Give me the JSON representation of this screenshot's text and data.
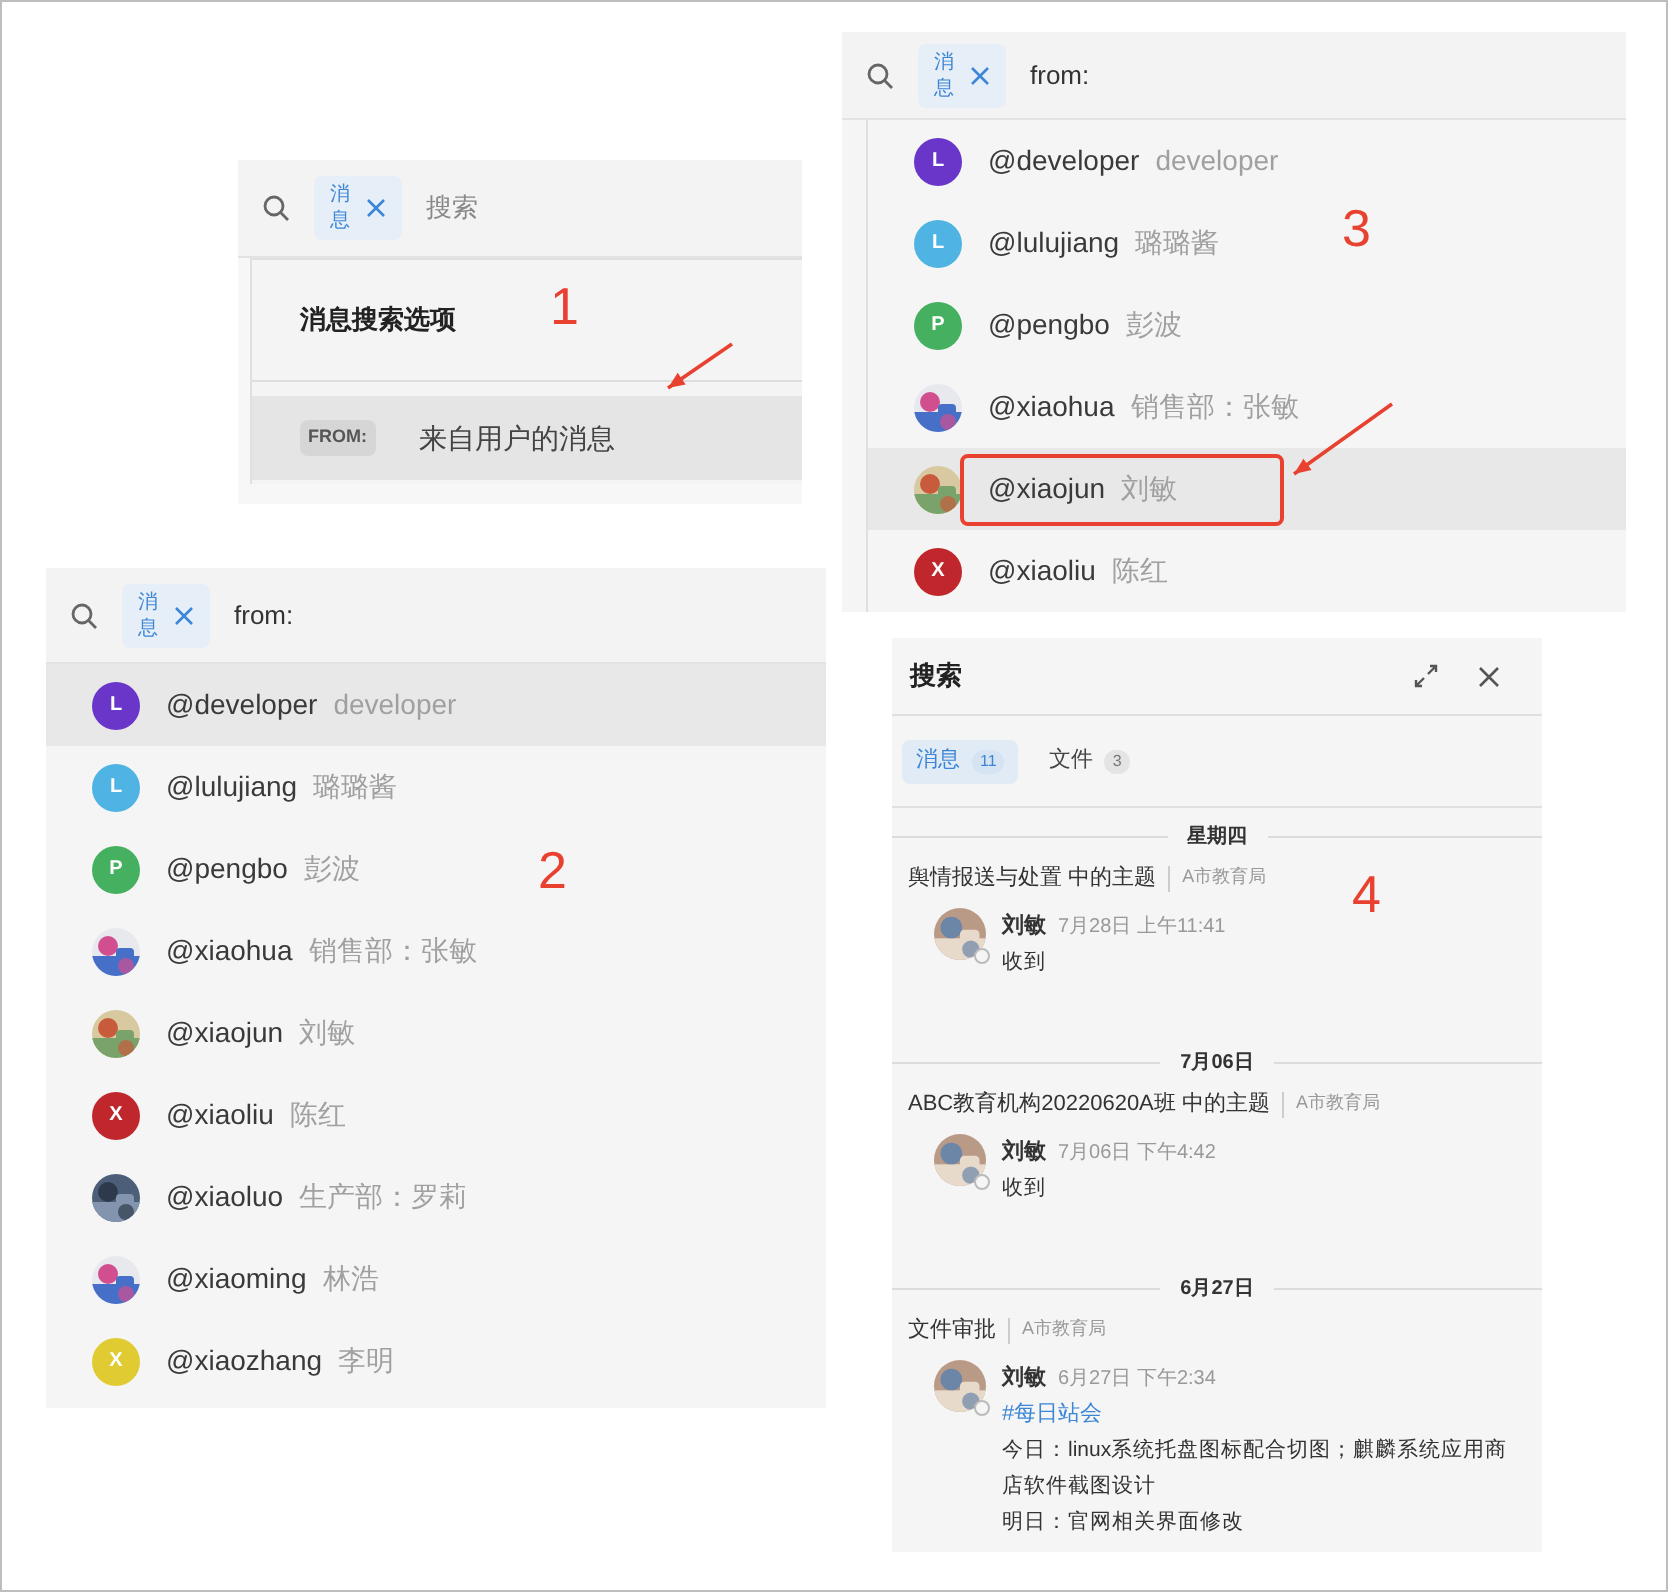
{
  "panel_1": {
    "annotation": "1",
    "search": {
      "chip": "消息",
      "placeholder": "搜索"
    },
    "dropdown": {
      "title": "消息搜索选项",
      "options": [
        {
          "badge": "FROM:",
          "label": "来自用户的消息",
          "selected": true
        }
      ]
    }
  },
  "panel_2": {
    "annotation": "2",
    "search": {
      "chip": "消息",
      "value": "from:"
    },
    "users": [
      {
        "handle": "@developer",
        "name": "developer",
        "avatar": {
          "kind": "letter",
          "letter": "L",
          "color": "#6a35c9"
        },
        "selected": true
      },
      {
        "handle": "@lulujiang",
        "name": "璐璐酱",
        "avatar": {
          "kind": "letter",
          "letter": "L",
          "color": "#4fb3e3"
        },
        "selected": false
      },
      {
        "handle": "@pengbo",
        "name": "彭波",
        "avatar": {
          "kind": "letter",
          "letter": "P",
          "color": "#45b060"
        },
        "selected": false
      },
      {
        "handle": "@xiaohua",
        "name": "销售部：张敏",
        "selected": false
      },
      {
        "handle": "@xiaojun",
        "name": "刘敏",
        "selected": false
      },
      {
        "handle": "@xiaoliu",
        "name": "陈红",
        "avatar": {
          "kind": "letter",
          "letter": "X",
          "color": "#c0272d"
        },
        "selected": false
      },
      {
        "handle": "@xiaoluo",
        "name": "生产部：罗莉",
        "selected": false
      },
      {
        "handle": "@xiaoming",
        "name": "林浩",
        "selected": false
      },
      {
        "handle": "@xiaozhang",
        "name": "李明",
        "avatar": {
          "kind": "letter",
          "letter": "X",
          "color": "#e0cc32"
        },
        "selected": false
      }
    ]
  },
  "panel_3": {
    "annotation": "3",
    "search": {
      "chip": "消息",
      "value": "from:"
    },
    "users": [
      {
        "handle": "@developer",
        "name": "developer",
        "avatar": {
          "kind": "letter",
          "letter": "L",
          "color": "#6a35c9"
        },
        "selected": false,
        "boxed": false
      },
      {
        "handle": "@lulujiang",
        "name": "璐璐酱",
        "avatar": {
          "kind": "letter",
          "letter": "L",
          "color": "#4fb3e3"
        },
        "selected": false,
        "boxed": false
      },
      {
        "handle": "@pengbo",
        "name": "彭波",
        "avatar": {
          "kind": "letter",
          "letter": "P",
          "color": "#45b060"
        },
        "selected": false,
        "boxed": false
      },
      {
        "handle": "@xiaohua",
        "name": "销售部：张敏",
        "selected": false,
        "boxed": false
      },
      {
        "handle": "@xiaojun",
        "name": "刘敏",
        "selected": true,
        "boxed": true
      },
      {
        "handle": "@xiaoliu",
        "name": "陈红",
        "avatar": {
          "kind": "letter",
          "letter": "X",
          "color": "#c0272d"
        },
        "selected": false,
        "boxed": false
      }
    ]
  },
  "panel_4": {
    "annotation": "4",
    "title": "搜索",
    "tabs": [
      {
        "label": "消息",
        "count": "11",
        "selected": true
      },
      {
        "label": "文件",
        "count": "3",
        "selected": false
      }
    ],
    "groups": [
      {
        "date": "星期四",
        "topic": "舆情报送与处置 中的主题",
        "org": "A市教育局",
        "author": "刘敏",
        "time": "7月28日 上午11:41",
        "lines": [
          {
            "kind": "text",
            "text": "收到"
          }
        ]
      },
      {
        "date": "7月06日",
        "topic": "ABC教育机构20220620A班 中的主题",
        "org": "A市教育局",
        "author": "刘敏",
        "time": "7月06日 下午4:42",
        "lines": [
          {
            "kind": "text",
            "text": "收到"
          }
        ]
      },
      {
        "date": "6月27日",
        "topic": "文件审批",
        "org": "A市教育局",
        "author": "刘敏",
        "time": "6月27日 下午2:34",
        "lines": [
          {
            "kind": "tag",
            "text": "#每日站会"
          },
          {
            "kind": "text",
            "text": "今日：linux系统托盘图标配合切图；麒麟系统应用商店软件截图设计"
          },
          {
            "kind": "text",
            "text": "明日：官网相关界面修改"
          }
        ]
      }
    ]
  }
}
